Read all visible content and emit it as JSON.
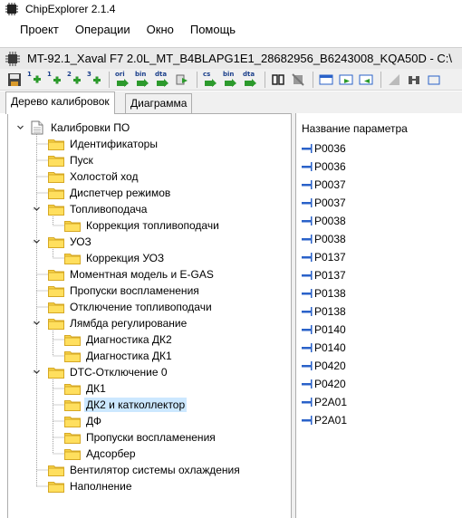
{
  "app": {
    "title": "ChipExplorer 2.1.4"
  },
  "menu": {
    "items": [
      "Проект",
      "Операции",
      "Окно",
      "Помощь"
    ]
  },
  "document": {
    "title": "MT-92.1_Xaval F7 2.0L_MT_B4BLAPG1E1_28682956_B6243008_KQA50D - C:\\"
  },
  "toolbar": {
    "buttons": [
      {
        "icon": "save-icon"
      },
      {
        "icon": "add-1-icon",
        "text": "1"
      },
      {
        "icon": "add-2-icon",
        "text": "1"
      },
      {
        "icon": "add-3-icon",
        "text": "2"
      },
      {
        "icon": "add-4-icon",
        "text": "3"
      },
      {
        "icon": "ori-icon",
        "text": "ori"
      },
      {
        "icon": "bin-icon",
        "text": "bin"
      },
      {
        "icon": "dta-icon",
        "text": "dta"
      },
      {
        "icon": "export-icon"
      },
      {
        "icon": "cs-icon",
        "text": "cs"
      },
      {
        "icon": "bin-2-icon",
        "text": "bin"
      },
      {
        "icon": "dta-2-icon",
        "text": "dta"
      },
      {
        "icon": "chip-icon"
      },
      {
        "icon": "chip-disabled-icon"
      },
      {
        "icon": "window-icon"
      },
      {
        "icon": "window-arrow-icon"
      },
      {
        "icon": "window-arrow-left-icon"
      },
      {
        "icon": "graph-icon"
      },
      {
        "icon": "compare-icon"
      },
      {
        "icon": "more-icon"
      }
    ]
  },
  "tabs": [
    {
      "label": "Дерево калибровок",
      "active": true
    },
    {
      "label": "Диаграмма",
      "active": false
    }
  ],
  "tree": {
    "root": "Калибровки ПО",
    "nodes": [
      {
        "label": "Идентификаторы",
        "level": 1,
        "expander": ""
      },
      {
        "label": "Пуск",
        "level": 1,
        "expander": ""
      },
      {
        "label": "Холостой ход",
        "level": 1,
        "expander": ""
      },
      {
        "label": "Диспетчер режимов",
        "level": 1,
        "expander": ""
      },
      {
        "label": "Топливоподача",
        "level": 1,
        "expander": "open"
      },
      {
        "label": "Коррекция топливоподачи",
        "level": 2,
        "expander": ""
      },
      {
        "label": "УОЗ",
        "level": 1,
        "expander": "open"
      },
      {
        "label": "Коррекция УОЗ",
        "level": 2,
        "expander": ""
      },
      {
        "label": "Моментная модель и E-GAS",
        "level": 1,
        "expander": ""
      },
      {
        "label": "Пропуски воспламенения",
        "level": 1,
        "expander": ""
      },
      {
        "label": "Отключение топливоподачи",
        "level": 1,
        "expander": ""
      },
      {
        "label": "Лямбда регулирование",
        "level": 1,
        "expander": "open"
      },
      {
        "label": "Диагностика ДК2",
        "level": 2,
        "expander": ""
      },
      {
        "label": "Диагностика ДК1",
        "level": 2,
        "expander": ""
      },
      {
        "label": "DTC-Отключение 0",
        "level": 1,
        "expander": "open"
      },
      {
        "label": "ДК1",
        "level": 2,
        "expander": ""
      },
      {
        "label": "ДК2 и катколлектор",
        "level": 2,
        "expander": "",
        "selected": true
      },
      {
        "label": "ДФ",
        "level": 2,
        "expander": ""
      },
      {
        "label": "Пропуски воспламенения",
        "level": 2,
        "expander": ""
      },
      {
        "label": "Адсорбер",
        "level": 2,
        "expander": ""
      },
      {
        "label": "Вентилятор системы охлаждения",
        "level": 1,
        "expander": ""
      },
      {
        "label": "Наполнение",
        "level": 1,
        "expander": ""
      }
    ]
  },
  "params": {
    "header": "Название параметра",
    "items": [
      "P0036",
      "P0036",
      "P0037",
      "P0037",
      "P0038",
      "P0038",
      "P0137",
      "P0137",
      "P0138",
      "P0138",
      "P0140",
      "P0140",
      "P0420",
      "P0420",
      "P2A01",
      "P2A01"
    ]
  },
  "colors": {
    "selection": "#cce8ff",
    "folder": "#f7d34a",
    "toolbar_bg": "#f0f0f0"
  }
}
